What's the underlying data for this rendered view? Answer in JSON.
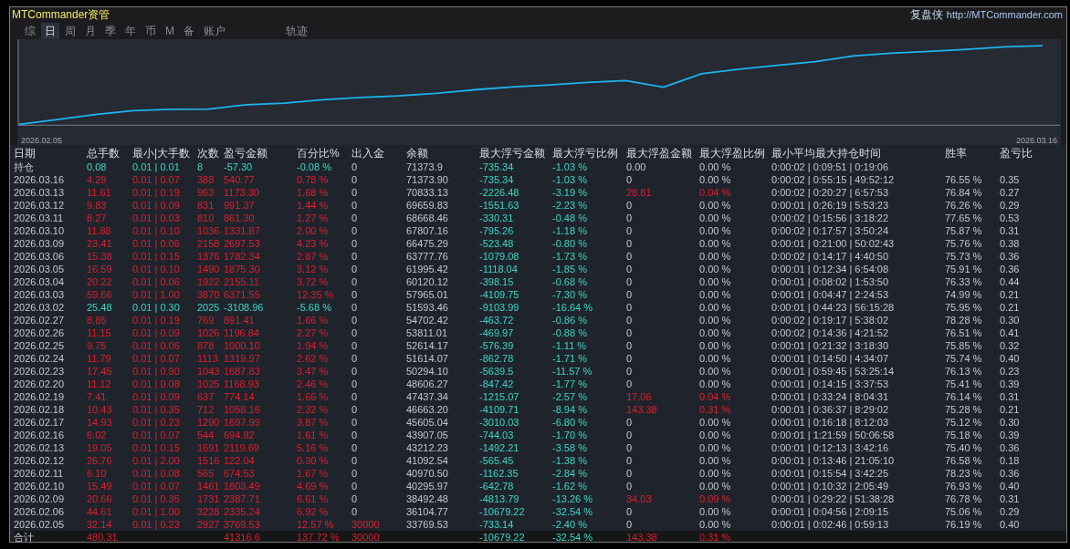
{
  "window": {
    "title": "MTCommander资管",
    "brand": "复盘侠",
    "url": "http://MTCommander.com"
  },
  "tabs": [
    {
      "label": "综",
      "selected": false
    },
    {
      "label": "日",
      "selected": true
    },
    {
      "label": "周",
      "selected": false
    },
    {
      "label": "月",
      "selected": false
    },
    {
      "label": "季",
      "selected": false
    },
    {
      "label": "年",
      "selected": false
    },
    {
      "label": "币",
      "selected": false
    },
    {
      "label": "M",
      "selected": false
    },
    {
      "label": "备",
      "selected": false
    },
    {
      "label": "账户",
      "selected": false
    },
    {
      "label": "轨迹",
      "selected": false
    }
  ],
  "chart": {
    "start_label": "2026.02.05",
    "end_label": "2026.03.16"
  },
  "table": {
    "columns": [
      "日期",
      "总手数",
      "最小|大手数",
      "次数",
      "盈亏金额",
      "百分比%",
      "出入金",
      "余额",
      "最大浮亏金额",
      "最大浮亏比例",
      "最大浮盈金额",
      "最大浮盈比例",
      "最小平均最大持仓时间",
      "胜率",
      "盈亏比"
    ],
    "rows": [
      {
        "kind": "position",
        "flow_marked": false,
        "float_gain_marked": false,
        "cells": [
          "持仓",
          "0.08",
          "0.01 | 0.01",
          "8",
          "-57.30",
          "-0.08 %",
          "0",
          "71373.9",
          "-735.34",
          "-1.03 %",
          "0.00",
          "0.00 %",
          "0:00:02 | 0:09:51 | 0:19:06",
          null,
          null
        ]
      },
      {
        "kind": "gain",
        "flow_marked": false,
        "float_gain_marked": false,
        "cells": [
          "2026.03.16",
          "4.29",
          "0.01 | 0.07",
          "388",
          "540.77",
          "0.78 %",
          "0",
          "71373.90",
          "-735.34",
          "-1.03 %",
          "0",
          "0.00 %",
          "0:00:02 | 0:55:15 | 49:52:12",
          "76.55 %",
          "0.35"
        ]
      },
      {
        "kind": "gain",
        "flow_marked": false,
        "float_gain_marked": true,
        "cells": [
          "2026.03.13",
          "11.61",
          "0.01 | 0.19",
          "963",
          "1173.30",
          "1.68 %",
          "0",
          "70833.13",
          "-2226.48",
          "-3.19 %",
          "28.81",
          "0.04 %",
          "0:00:02 | 0:20:27 | 6:57:53",
          "76.84 %",
          "0.27"
        ]
      },
      {
        "kind": "gain",
        "flow_marked": false,
        "float_gain_marked": false,
        "cells": [
          "2026.03.12",
          "9.83",
          "0.01 | 0.09",
          "831",
          "991.37",
          "1.44 %",
          "0",
          "69659.83",
          "-1551.63",
          "-2.23 %",
          "0",
          "0.00 %",
          "0:00:01 | 0:26:19 | 5:53:23",
          "76.26 %",
          "0.29"
        ]
      },
      {
        "kind": "gain",
        "flow_marked": false,
        "float_gain_marked": false,
        "cells": [
          "2026.03.11",
          "8.27",
          "0.01 | 0.03",
          "810",
          "861.30",
          "1.27 %",
          "0",
          "68668.46",
          "-330.31",
          "-0.48 %",
          "0",
          "0.00 %",
          "0:00:02 | 0:15:56 | 3:18:22",
          "77.65 %",
          "0.53"
        ]
      },
      {
        "kind": "gain",
        "flow_marked": false,
        "float_gain_marked": false,
        "cells": [
          "2026.03.10",
          "11.88",
          "0.01 | 0.10",
          "1036",
          "1331.87",
          "2.00 %",
          "0",
          "67807.16",
          "-795.26",
          "-1.18 %",
          "0",
          "0.00 %",
          "0:00:02 | 0:17:57 | 3:50:24",
          "75.87 %",
          "0.31"
        ]
      },
      {
        "kind": "gain",
        "flow_marked": false,
        "float_gain_marked": false,
        "cells": [
          "2026.03.09",
          "23.41",
          "0.01 | 0.06",
          "2158",
          "2697.53",
          "4.23 %",
          "0",
          "66475.29",
          "-523.48",
          "-0.80 %",
          "0",
          "0.00 %",
          "0:00:01 | 0:21:00 | 50:02:43",
          "75.76 %",
          "0.38"
        ]
      },
      {
        "kind": "gain",
        "flow_marked": false,
        "float_gain_marked": false,
        "cells": [
          "2026.03.06",
          "15.38",
          "0.01 | 0.15",
          "1376",
          "1782.34",
          "2.87 %",
          "0",
          "63777.76",
          "-1079.08",
          "-1.73 %",
          "0",
          "0.00 %",
          "0:00:02 | 0:14:17 | 4:40:50",
          "75.73 %",
          "0.36"
        ]
      },
      {
        "kind": "gain",
        "flow_marked": false,
        "float_gain_marked": false,
        "cells": [
          "2026.03.05",
          "16.59",
          "0.01 | 0.10",
          "1490",
          "1875.30",
          "3.12 %",
          "0",
          "61995.42",
          "-1118.04",
          "-1.85 %",
          "0",
          "0.00 %",
          "0:00:01 | 0:12:34 | 6:54:08",
          "75.91 %",
          "0.36"
        ]
      },
      {
        "kind": "gain",
        "flow_marked": false,
        "float_gain_marked": false,
        "cells": [
          "2026.03.04",
          "20.22",
          "0.01 | 0.06",
          "1922",
          "2155.11",
          "3.72 %",
          "0",
          "60120.12",
          "-398.15",
          "-0.68 %",
          "0",
          "0.00 %",
          "0:00:01 | 0:08:02 | 1:53:50",
          "76.33 %",
          "0.44"
        ]
      },
      {
        "kind": "gain",
        "flow_marked": false,
        "float_gain_marked": false,
        "cells": [
          "2026.03.03",
          "59.66",
          "0.01 | 1.00",
          "3870",
          "6371.55",
          "12.35 %",
          "0",
          "57965.01",
          "-4109.75",
          "-7.30 %",
          "0",
          "0.00 %",
          "0:00:01 | 0:04:47 | 2:24:53",
          "74.99 %",
          "0.21"
        ]
      },
      {
        "kind": "loss",
        "flow_marked": false,
        "float_gain_marked": false,
        "cells": [
          "2026.03.02",
          "25.48",
          "0.01 | 0.30",
          "2025",
          "-3108.96",
          "-5.68 %",
          "0",
          "51593.46",
          "-9103.99",
          "-16.64 %",
          "0",
          "0.00 %",
          "0:00:01 | 0:44:23 | 56:15:28",
          "75.95 %",
          "0.21"
        ]
      },
      {
        "kind": "gain",
        "flow_marked": false,
        "float_gain_marked": false,
        "cells": [
          "2026.02.27",
          "8.85",
          "0.01 | 0.19",
          "769",
          "891.41",
          "1.66 %",
          "0",
          "54702.42",
          "-463.72",
          "-0.86 %",
          "0",
          "0.00 %",
          "0:00:02 | 0:19:17 | 5:38:02",
          "78.28 %",
          "0.30"
        ]
      },
      {
        "kind": "gain",
        "flow_marked": false,
        "float_gain_marked": false,
        "cells": [
          "2026.02.26",
          "11.15",
          "0.01 | 0.09",
          "1026",
          "1196.84",
          "2.27 %",
          "0",
          "53811.01",
          "-469.97",
          "-0.88 %",
          "0",
          "0.00 %",
          "0:00:02 | 0:14:36 | 4:21:52",
          "76.51 %",
          "0.41"
        ]
      },
      {
        "kind": "gain",
        "flow_marked": false,
        "float_gain_marked": false,
        "cells": [
          "2026.02.25",
          "9.75",
          "0.01 | 0.06",
          "878",
          "1000.10",
          "1.94 %",
          "0",
          "52614.17",
          "-576.39",
          "-1.11 %",
          "0",
          "0.00 %",
          "0:00:01 | 0:21:32 | 3:18:30",
          "75.85 %",
          "0.32"
        ]
      },
      {
        "kind": "gain",
        "flow_marked": false,
        "float_gain_marked": false,
        "cells": [
          "2026.02.24",
          "11.79",
          "0.01 | 0.07",
          "1113",
          "1319.97",
          "2.62 %",
          "0",
          "51614.07",
          "-862.78",
          "-1.71 %",
          "0",
          "0.00 %",
          "0:00:01 | 0:14:50 | 4:34:07",
          "75.74 %",
          "0.40"
        ]
      },
      {
        "kind": "gain",
        "flow_marked": false,
        "float_gain_marked": false,
        "cells": [
          "2026.02.23",
          "17.45",
          "0.01 | 0.90",
          "1043",
          "1687.83",
          "3.47 %",
          "0",
          "50294.10",
          "-5639.5",
          "-11.57 %",
          "0",
          "0.00 %",
          "0:00:01 | 0:59:45 | 53:25:14",
          "76.13 %",
          "0.23"
        ]
      },
      {
        "kind": "gain",
        "flow_marked": false,
        "float_gain_marked": false,
        "cells": [
          "2026.02.20",
          "11.12",
          "0.01 | 0.08",
          "1025",
          "1168.93",
          "2.46 %",
          "0",
          "48606.27",
          "-847.42",
          "-1.77 %",
          "0",
          "0.00 %",
          "0:00:01 | 0:14:15 | 3:37:53",
          "75.41 %",
          "0.39"
        ]
      },
      {
        "kind": "gain",
        "flow_marked": false,
        "float_gain_marked": true,
        "cells": [
          "2026.02.19",
          "7.41",
          "0.01 | 0.09",
          "637",
          "774.14",
          "1.66 %",
          "0",
          "47437.34",
          "-1215.07",
          "-2.57 %",
          "17.06",
          "0.04 %",
          "0:00:01 | 0:33:24 | 8:04:31",
          "76.14 %",
          "0.31"
        ]
      },
      {
        "kind": "gain",
        "flow_marked": false,
        "float_gain_marked": true,
        "cells": [
          "2026.02.18",
          "10.43",
          "0.01 | 0.35",
          "712",
          "1058.16",
          "2.32 %",
          "0",
          "46663.20",
          "-4109.71",
          "-8.94 %",
          "143.38",
          "0.31 %",
          "0:00:01 | 0:36:37 | 8:29:02",
          "75.28 %",
          "0.21"
        ]
      },
      {
        "kind": "gain",
        "flow_marked": false,
        "float_gain_marked": false,
        "cells": [
          "2026.02.17",
          "14.93",
          "0.01 | 0.23",
          "1290",
          "1697.99",
          "3.87 %",
          "0",
          "45605.04",
          "-3010.03",
          "-6.80 %",
          "0",
          "0.00 %",
          "0:00:01 | 0:16:18 | 8:12:03",
          "75.12 %",
          "0.30"
        ]
      },
      {
        "kind": "gain",
        "flow_marked": false,
        "float_gain_marked": false,
        "cells": [
          "2026.02.16",
          "6.02",
          "0.01 | 0.07",
          "544",
          "694.82",
          "1.61 %",
          "0",
          "43907.05",
          "-744.03",
          "-1.70 %",
          "0",
          "0.00 %",
          "0:00:01 | 1:21:59 | 50:06:58",
          "75.18 %",
          "0.39"
        ]
      },
      {
        "kind": "gain",
        "flow_marked": false,
        "float_gain_marked": false,
        "cells": [
          "2026.02.13",
          "19.05",
          "0.01 | 0.15",
          "1691",
          "2119.69",
          "5.16 %",
          "0",
          "43212.23",
          "-1492.21",
          "-3.58 %",
          "0",
          "0.00 %",
          "0:00:01 | 0:12:13 | 3:42:16",
          "75.40 %",
          "0.36"
        ]
      },
      {
        "kind": "gain",
        "flow_marked": false,
        "float_gain_marked": false,
        "cells": [
          "2026.02.12",
          "26.76",
          "0.01 | 2.00",
          "1516",
          "122.04",
          "0.30 %",
          "0",
          "41092.54",
          "-565.45",
          "-1.38 %",
          "0",
          "0.00 %",
          "0:00:01 | 0:13:46 | 21:05:10",
          "76.58 %",
          "0.18"
        ]
      },
      {
        "kind": "gain",
        "flow_marked": false,
        "float_gain_marked": false,
        "cells": [
          "2026.02.11",
          "6.10",
          "0.01 | 0.08",
          "565",
          "674.53",
          "1.67 %",
          "0",
          "40970.50",
          "-1162.35",
          "-2.84 %",
          "0",
          "0.00 %",
          "0:00:01 | 0:15:54 | 3:42:25",
          "78.23 %",
          "0.36"
        ]
      },
      {
        "kind": "gain",
        "flow_marked": false,
        "float_gain_marked": false,
        "cells": [
          "2026.02.10",
          "15.49",
          "0.01 | 0.07",
          "1461",
          "1803.49",
          "4.69 %",
          "0",
          "40295.97",
          "-642.78",
          "-1.62 %",
          "0",
          "0.00 %",
          "0:00:01 | 0:10:32 | 2:05:49",
          "76.93 %",
          "0.40"
        ]
      },
      {
        "kind": "gain",
        "flow_marked": false,
        "float_gain_marked": true,
        "cells": [
          "2026.02.09",
          "20.66",
          "0.01 | 0.35",
          "1731",
          "2387.71",
          "6.61 %",
          "0",
          "38492.48",
          "-4813.79",
          "-13.26 %",
          "34.03",
          "0.09 %",
          "0:00:01 | 0:29:22 | 51:38:28",
          "76.78 %",
          "0.31"
        ]
      },
      {
        "kind": "gain",
        "flow_marked": false,
        "float_gain_marked": false,
        "cells": [
          "2026.02.06",
          "44.61",
          "0.01 | 1.00",
          "3228",
          "2335.24",
          "6.92 %",
          "0",
          "36104.77",
          "-10679.22",
          "-32.54 %",
          "0",
          "0.00 %",
          "0:00:01 | 0:04:56 | 2:09:15",
          "75.06 %",
          "0.29"
        ]
      },
      {
        "kind": "gain",
        "flow_marked": true,
        "float_gain_marked": false,
        "cells": [
          "2026.02.05",
          "32.14",
          "0.01 | 0.23",
          "2927",
          "3769.53",
          "12.57 %",
          "30000",
          "33769.53",
          "-733.14",
          "-2.40 %",
          "0",
          "0.00 %",
          "0:00:01 | 0:02:46 | 0:59:13",
          "76.19 %",
          "0.40"
        ]
      },
      {
        "kind": "total",
        "flow_marked": true,
        "float_gain_marked": true,
        "cells": [
          "合计",
          "480.31",
          null,
          null,
          "41316.6",
          "137.72 %",
          "30000",
          null,
          "-10679.22",
          "-32.54 %",
          "143.38",
          "0.31 %",
          null,
          null,
          null
        ]
      }
    ]
  }
}
